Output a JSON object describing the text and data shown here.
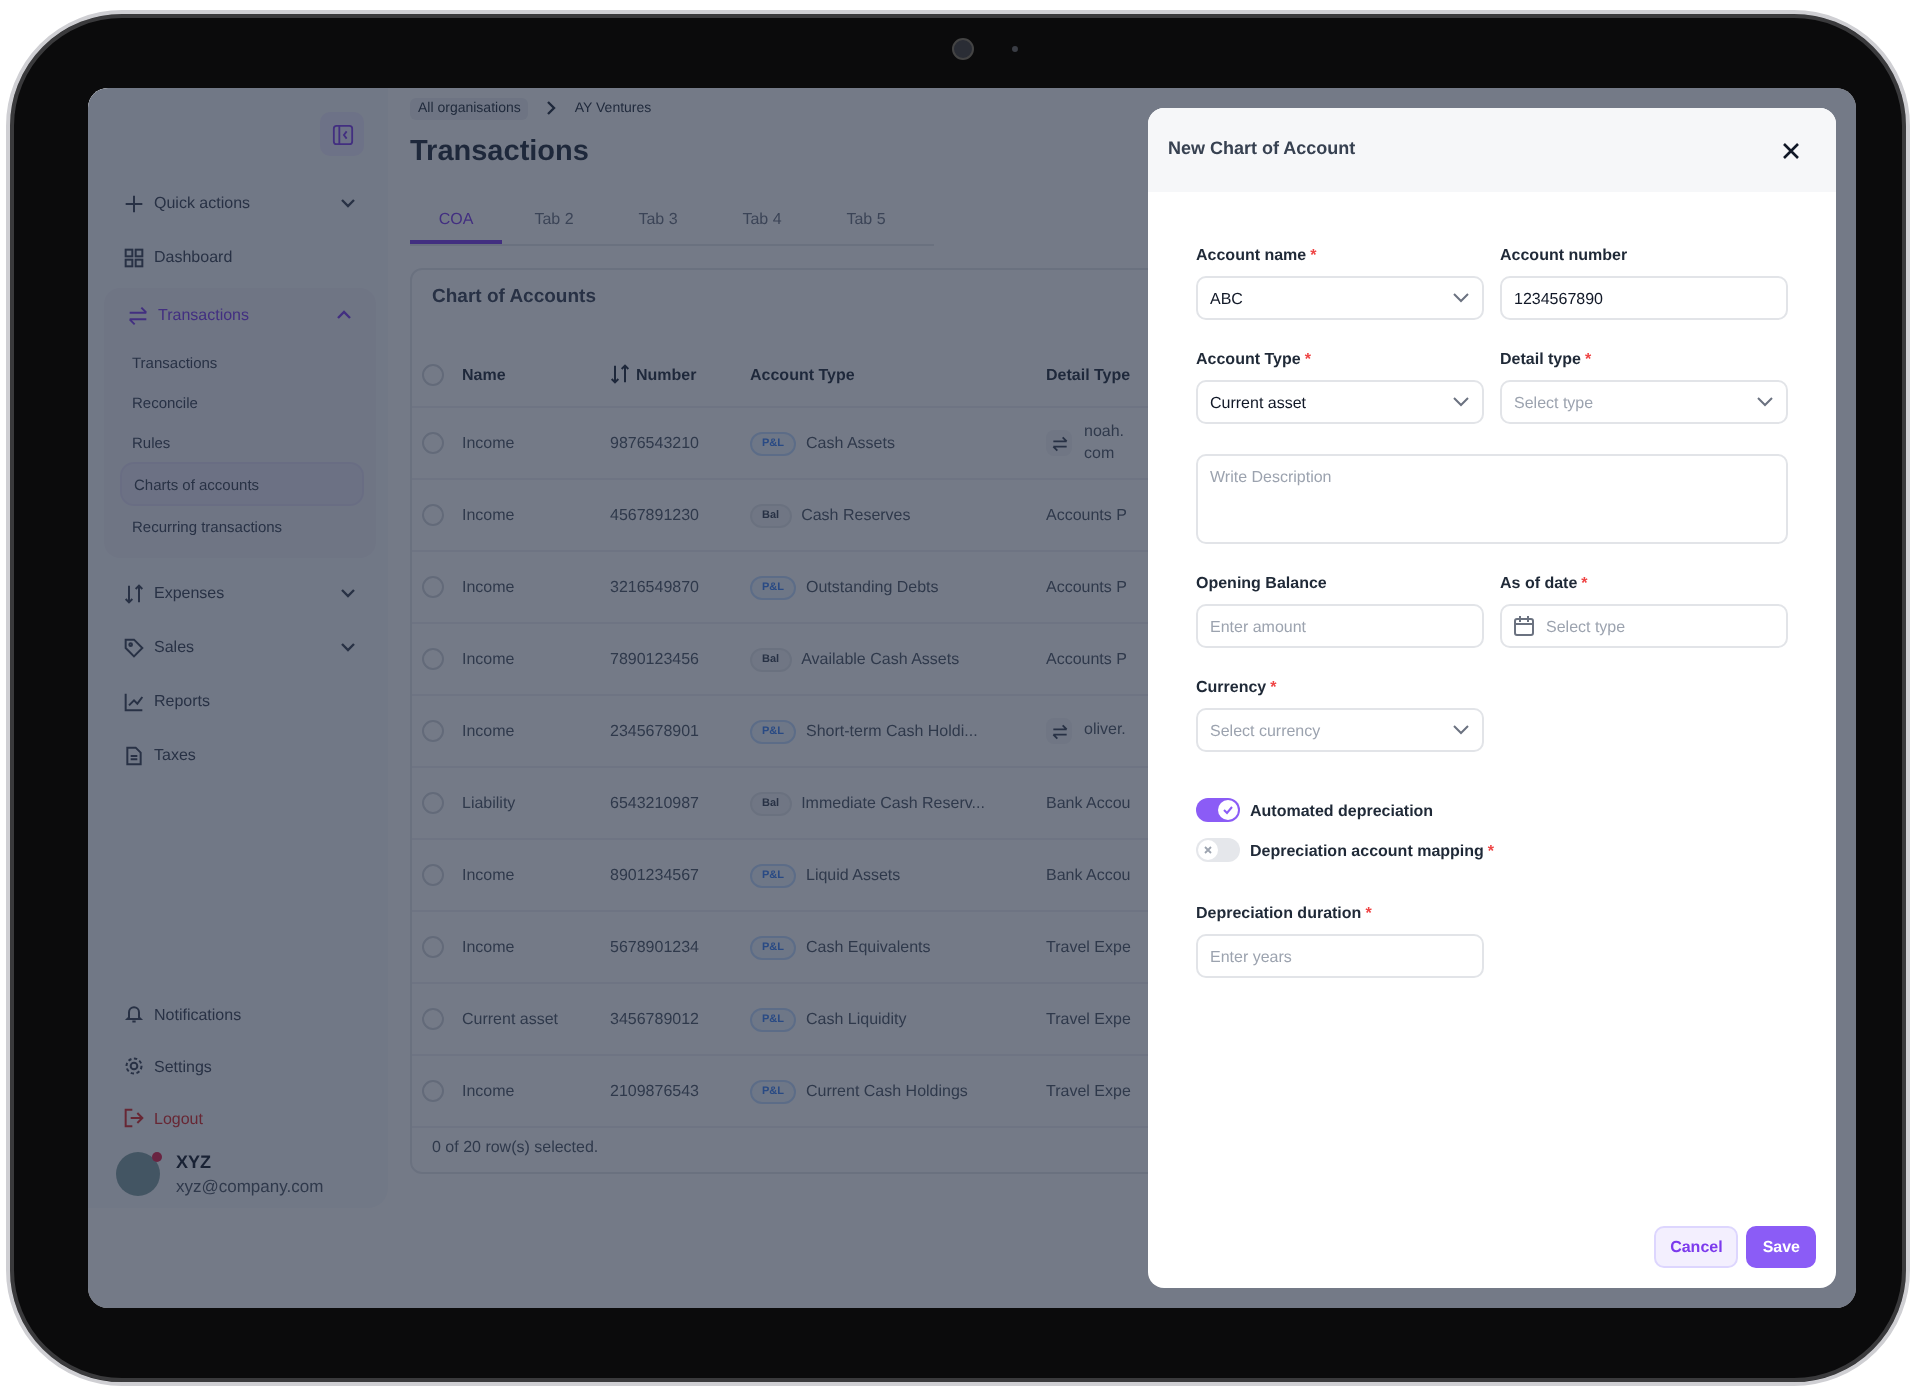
{
  "sidebar": {
    "items": [
      {
        "label": "Quick actions",
        "expandable": true,
        "expanded": false
      },
      {
        "label": "Dashboard",
        "expandable": false
      },
      {
        "label": "Transactions",
        "expandable": true,
        "expanded": true,
        "children": [
          {
            "label": "Transactions",
            "selected": false
          },
          {
            "label": "Reconcile",
            "selected": false
          },
          {
            "label": "Rules",
            "selected": false
          },
          {
            "label": "Charts of accounts",
            "selected": true
          },
          {
            "label": "Recurring transactions",
            "selected": false
          }
        ]
      },
      {
        "label": "Expenses",
        "expandable": true,
        "expanded": false
      },
      {
        "label": "Sales",
        "expandable": true,
        "expanded": false
      },
      {
        "label": "Reports",
        "expandable": false
      },
      {
        "label": "Taxes",
        "expandable": false
      }
    ],
    "footer": [
      {
        "label": "Notifications",
        "kind": "normal"
      },
      {
        "label": "Settings",
        "kind": "normal"
      },
      {
        "label": "Logout",
        "kind": "danger"
      }
    ],
    "user": {
      "name": "XYZ",
      "email": "xyz@company.com"
    }
  },
  "breadcrumb": [
    "All organisations",
    "AY Ventures"
  ],
  "title": "Transactions",
  "tabs": [
    {
      "label": "COA",
      "selected": true
    },
    {
      "label": "Tab 2",
      "selected": false
    },
    {
      "label": "Tab 3",
      "selected": false
    },
    {
      "label": "Tab 4",
      "selected": false
    },
    {
      "label": "Tab 5",
      "selected": false
    }
  ],
  "table": {
    "title": "Chart of Accounts",
    "select_all_checked": false,
    "columns": [
      "Name",
      "Number",
      "Account Type",
      "Detail Type"
    ],
    "rows": [
      {
        "checked": false,
        "name": "Income",
        "number": "9876543210",
        "badge": {
          "label": "P&L",
          "kind": "pl"
        },
        "account_type": "Cash Assets",
        "detail": "noah. com",
        "detail_link": true
      },
      {
        "checked": false,
        "name": "Income",
        "number": "4567891230",
        "badge": {
          "label": "Bal",
          "kind": "bal"
        },
        "account_type": "Cash Reserves",
        "detail": "Accounts P",
        "detail_link": false
      },
      {
        "checked": false,
        "name": "Income",
        "number": "3216549870",
        "badge": {
          "label": "P&L",
          "kind": "pl"
        },
        "account_type": "Outstanding Debts",
        "detail": "Accounts P",
        "detail_link": false
      },
      {
        "checked": false,
        "name": "Income",
        "number": "7890123456",
        "badge": {
          "label": "Bal",
          "kind": "bal"
        },
        "account_type": "Available Cash Assets",
        "detail": "Accounts P",
        "detail_link": false
      },
      {
        "checked": false,
        "name": "Income",
        "number": "2345678901",
        "badge": {
          "label": "P&L",
          "kind": "pl"
        },
        "account_type": "Short-term Cash Holdi...",
        "detail": "oliver.",
        "detail_link": true
      },
      {
        "checked": false,
        "name": "Liability",
        "number": "6543210987",
        "badge": {
          "label": "Bal",
          "kind": "bal"
        },
        "account_type": "Immediate Cash Reserv...",
        "detail": "Bank Accou",
        "detail_link": false
      },
      {
        "checked": false,
        "name": "Income",
        "number": "8901234567",
        "badge": {
          "label": "P&L",
          "kind": "pl"
        },
        "account_type": "Liquid Assets",
        "detail": "Bank Accou",
        "detail_link": false
      },
      {
        "checked": false,
        "name": "Income",
        "number": "5678901234",
        "badge": {
          "label": "P&L",
          "kind": "pl"
        },
        "account_type": "Cash Equivalents",
        "detail": "Travel Expe",
        "detail_link": false
      },
      {
        "checked": false,
        "name": "Current asset",
        "number": "3456789012",
        "badge": {
          "label": "P&L",
          "kind": "pl"
        },
        "account_type": "Cash Liquidity",
        "detail": "Travel Expe",
        "detail_link": false
      },
      {
        "checked": false,
        "name": "Income",
        "number": "2109876543",
        "badge": {
          "label": "P&L",
          "kind": "pl"
        },
        "account_type": "Current Cash Holdings",
        "detail": "Travel Expe",
        "detail_link": false
      }
    ],
    "footer": "0 of 20 row(s) selected."
  },
  "modal": {
    "title": "New Chart of Account",
    "rows_top": [
      [
        {
          "kind": "select",
          "label": "Account name",
          "required_mark": "*",
          "value": "ABC"
        },
        {
          "kind": "input",
          "label": "Account number",
          "value": "1234567890"
        }
      ],
      [
        {
          "kind": "select",
          "label": "Account Type",
          "required_mark": "*",
          "value": "Current asset"
        },
        {
          "kind": "select",
          "label": "Detail type",
          "required_mark": "*",
          "placeholder": "Select type"
        }
      ],
      [
        {
          "kind": "textarea",
          "placeholder": "Write Description"
        }
      ],
      [
        {
          "kind": "input",
          "label": "Opening Balance",
          "placeholder": "Enter amount"
        },
        {
          "kind": "date",
          "label": "As of date",
          "required_mark": "*",
          "placeholder": "Select type"
        }
      ],
      [
        {
          "kind": "select",
          "label": "Currency",
          "required_mark": "*",
          "placeholder": "Select currency"
        }
      ]
    ],
    "toggles": [
      {
        "label": "Automated depreciation",
        "on": true
      },
      {
        "label": "Depreciation account mapping",
        "on": false,
        "required_mark": "*"
      }
    ],
    "rows_bottom": [
      [
        {
          "kind": "input",
          "label": "Depreciation duration",
          "required_mark": "*",
          "placeholder": "Enter years"
        }
      ]
    ],
    "buttons": [
      {
        "label": "Cancel",
        "kind": "secondary"
      },
      {
        "label": "Save",
        "kind": "primary"
      }
    ]
  }
}
